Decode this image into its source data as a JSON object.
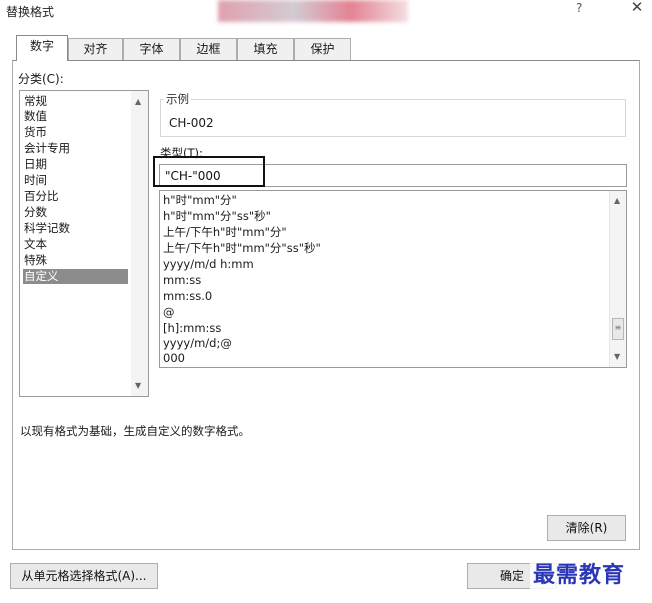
{
  "window": {
    "title": "替换格式",
    "help_label": "?",
    "close_label": "✕"
  },
  "tabs": [
    {
      "label": "数字",
      "active": true
    },
    {
      "label": "对齐"
    },
    {
      "label": "字体"
    },
    {
      "label": "边框"
    },
    {
      "label": "填充"
    },
    {
      "label": "保护"
    }
  ],
  "category": {
    "label": "分类(C):",
    "items": [
      "常规",
      "数值",
      "货币",
      "会计专用",
      "日期",
      "时间",
      "百分比",
      "分数",
      "科学记数",
      "文本",
      "特殊",
      "自定义"
    ],
    "selected": "自定义"
  },
  "sample": {
    "label": "示例",
    "value": "CH-002"
  },
  "type": {
    "label": "类型(T):",
    "value": "\"CH-\"000"
  },
  "format_list": {
    "items": [
      "h\"时\"mm\"分\"",
      "h\"时\"mm\"分\"ss\"秒\"",
      "上午/下午h\"时\"mm\"分\"",
      "上午/下午h\"时\"mm\"分\"ss\"秒\"",
      "yyyy/m/d h:mm",
      "mm:ss",
      "mm:ss.0",
      "@",
      "[h]:mm:ss",
      "yyyy/m/d;@",
      "000"
    ]
  },
  "description": "以现有格式为基础，生成自定义的数字格式。",
  "buttons": {
    "clear": "清除(R)",
    "pick_from_cell": "从单元格选择格式(A)...",
    "ok": "确定"
  },
  "watermark": "最需教育",
  "icons": {
    "scroll_up": "▲",
    "scroll_down": "▼",
    "scroll_thumb": "≡"
  }
}
